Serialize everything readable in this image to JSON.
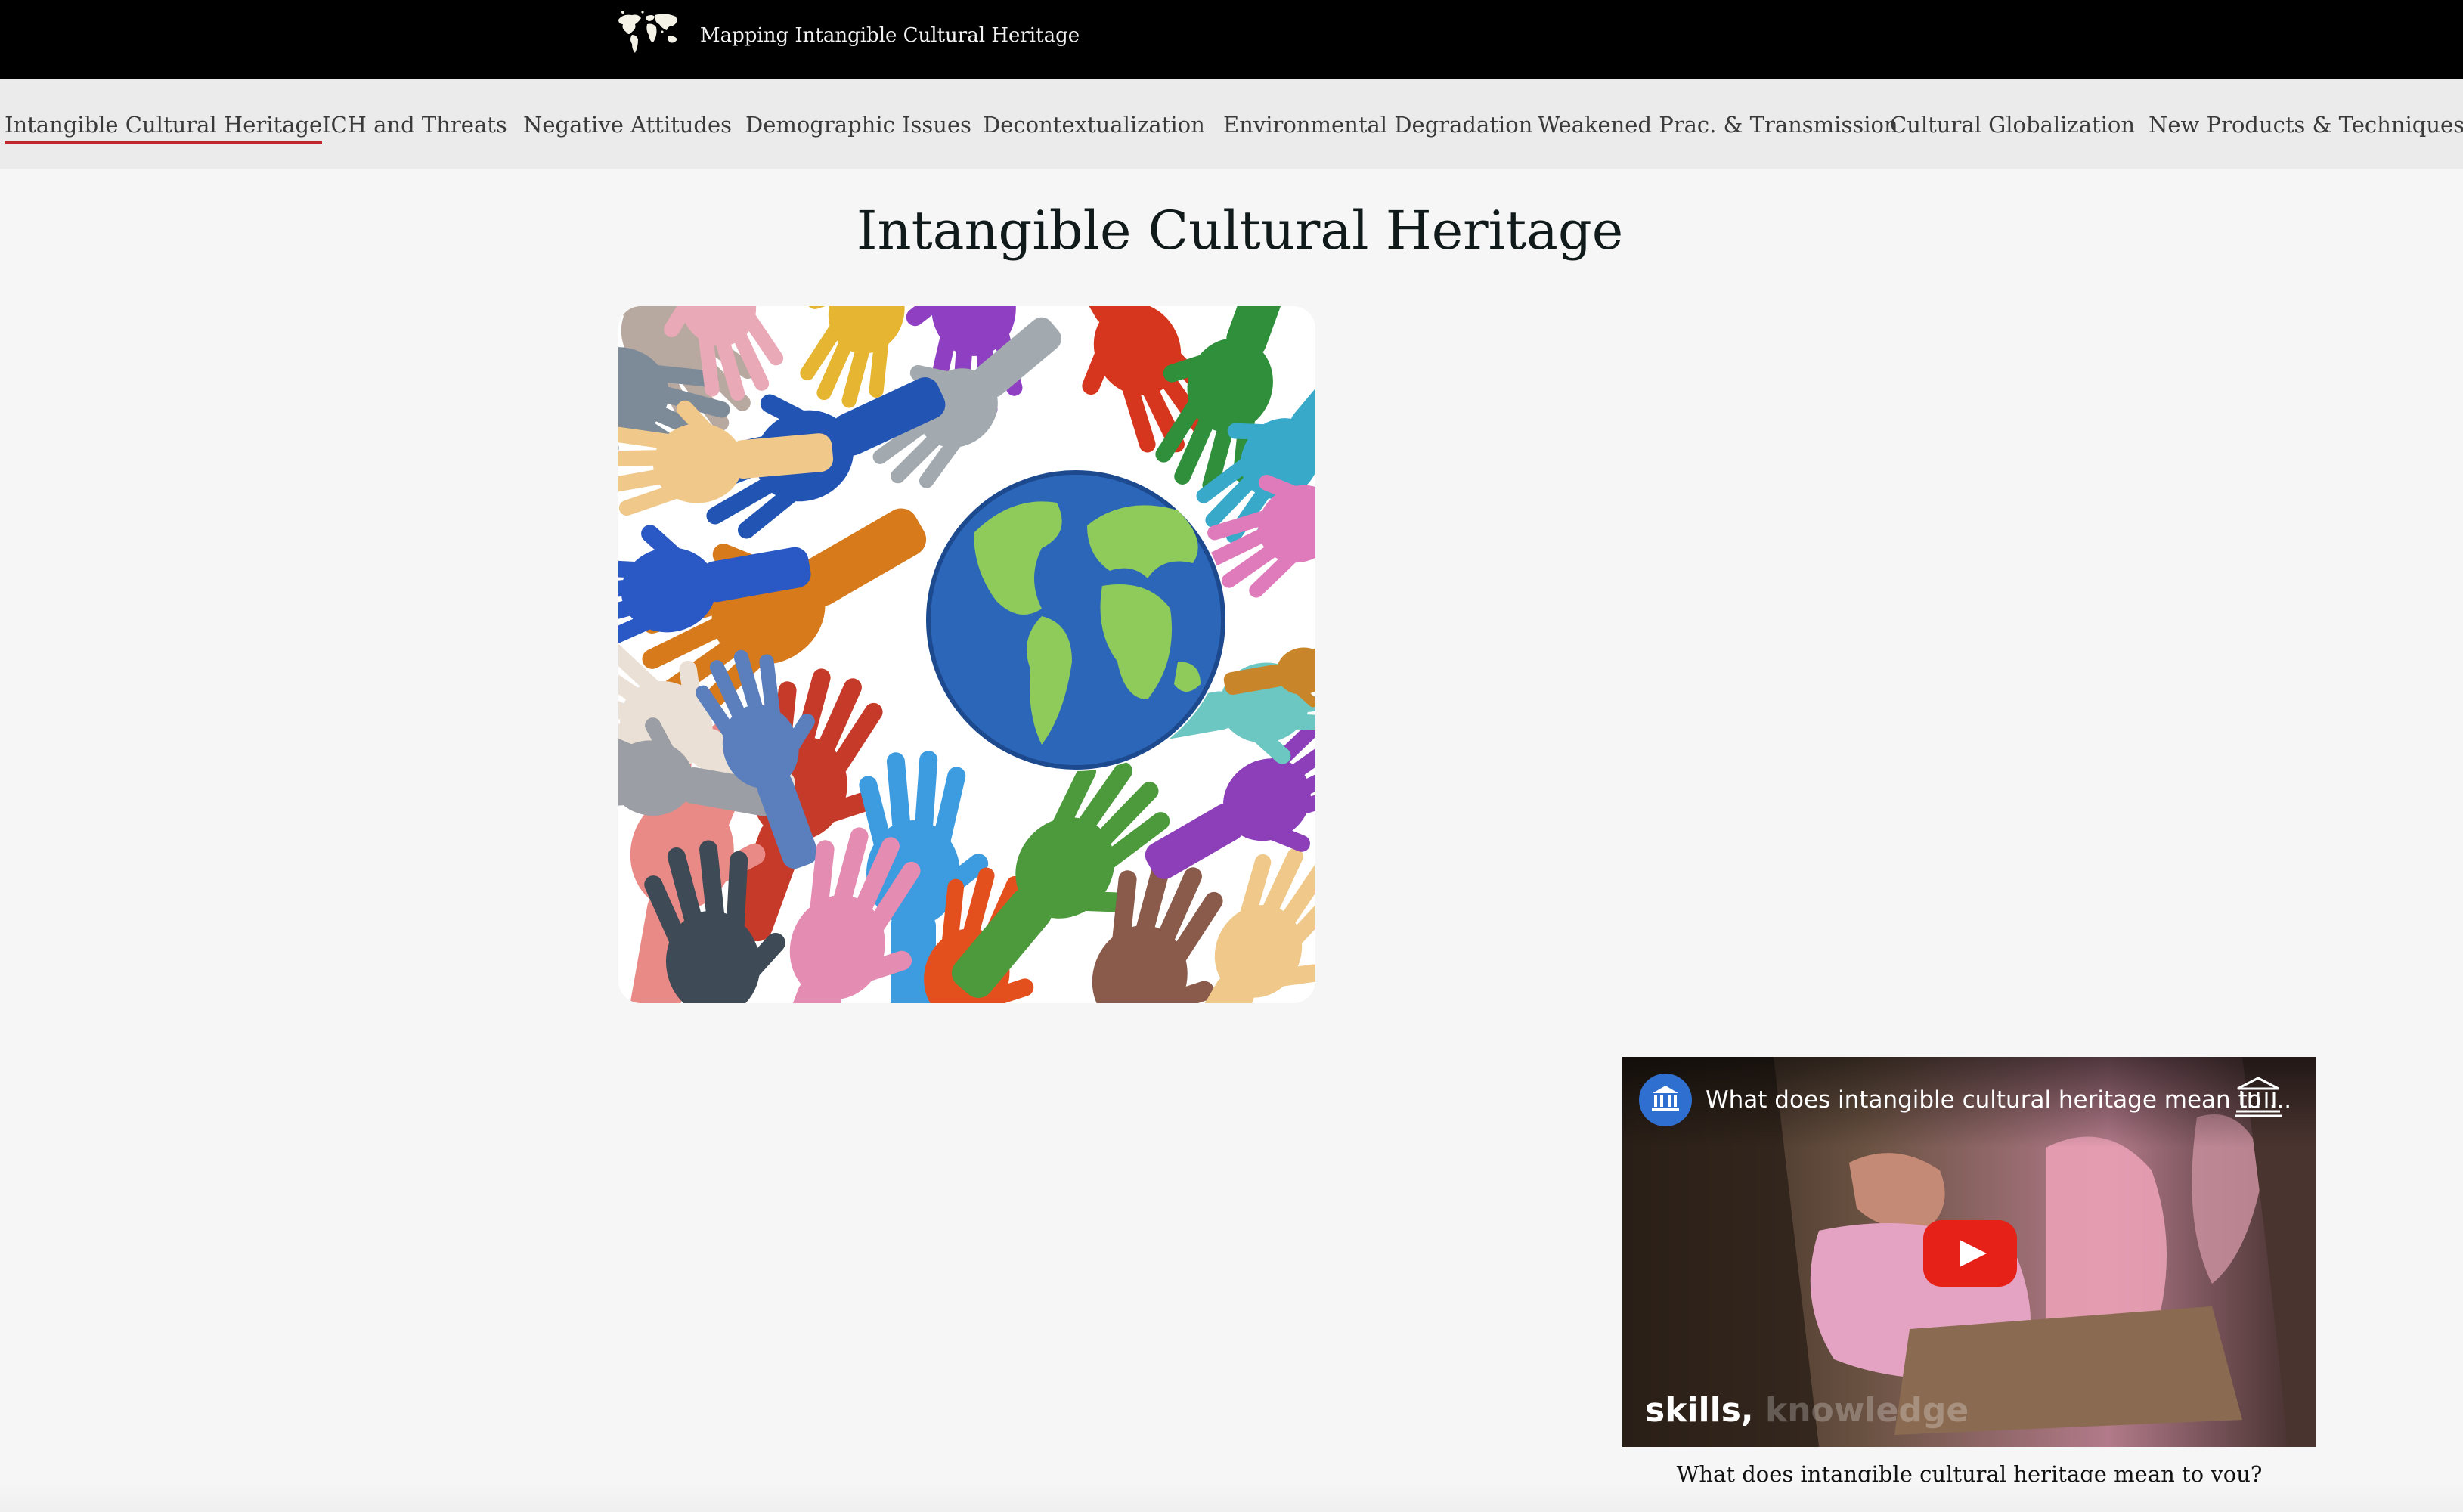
{
  "header": {
    "site_title": "Mapping Intangible Cultural Heritage",
    "logo_icon": "world-map-icon"
  },
  "nav": {
    "items": [
      {
        "label": "Intangible Cultural Heritage",
        "active": true
      },
      {
        "label": "ICH and Threats"
      },
      {
        "label": "Negative Attitudes"
      },
      {
        "label": "Demographic Issues"
      },
      {
        "label": "Decontextualization"
      },
      {
        "label": "Environmental Degradation"
      },
      {
        "label": "Weakened Prac. & Transmission"
      },
      {
        "label": "Cultural Globalization"
      },
      {
        "label": "New Products & Techniques"
      }
    ],
    "active_color": "#c0262d"
  },
  "main": {
    "title": "Intangible Cultural Heritage",
    "hero_image": "colorful-hands-around-globe-image"
  },
  "video": {
    "title": "What does intangible cultural heritage mean to ...",
    "overlay_caption_1": "skills,",
    "overlay_caption_2": "knowledge",
    "play_icon": "youtube-play-icon",
    "channel_icon": "unesco-temple-icon",
    "caption": "What does intangible cultural heritage mean to you?",
    "play_button_color": "#e62117"
  }
}
